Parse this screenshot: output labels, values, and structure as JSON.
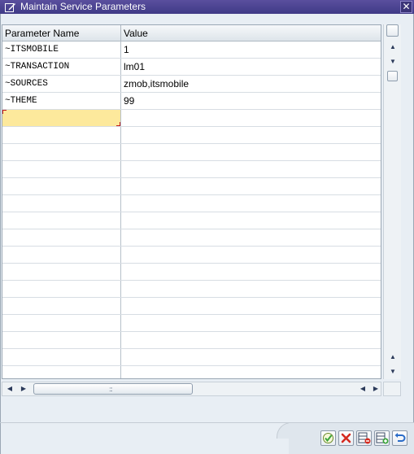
{
  "window": {
    "title": "Maintain Service Parameters",
    "close_glyph": "✕"
  },
  "table": {
    "columns": [
      "Parameter Name",
      "Value"
    ],
    "rows": [
      {
        "name": "~ITSMOBILE",
        "value": "1"
      },
      {
        "name": "~TRANSACTION",
        "value": "lm01"
      },
      {
        "name": "~SOURCES",
        "value": "zmob,itsmobile"
      },
      {
        "name": "~THEME",
        "value": "99"
      },
      {
        "name": "",
        "value": ""
      },
      {
        "name": "",
        "value": ""
      },
      {
        "name": "",
        "value": ""
      },
      {
        "name": "",
        "value": ""
      },
      {
        "name": "",
        "value": ""
      },
      {
        "name": "",
        "value": ""
      },
      {
        "name": "",
        "value": ""
      },
      {
        "name": "",
        "value": ""
      },
      {
        "name": "",
        "value": ""
      },
      {
        "name": "",
        "value": ""
      },
      {
        "name": "",
        "value": ""
      },
      {
        "name": "",
        "value": ""
      },
      {
        "name": "",
        "value": ""
      },
      {
        "name": "",
        "value": ""
      },
      {
        "name": "",
        "value": ""
      },
      {
        "name": "",
        "value": ""
      },
      {
        "name": "",
        "value": ""
      }
    ],
    "active_row": 4
  },
  "icons": {
    "title": "window-edit-icon",
    "toolbar": [
      "continue-icon",
      "cancel-icon",
      "delete-row-icon",
      "insert-row-icon",
      "undo-icon"
    ]
  },
  "colors": {
    "titlebar": "#45408c",
    "active_cell": "#fde99c",
    "cancel_red": "#d42a1f",
    "check_green": "#3aa43a"
  }
}
